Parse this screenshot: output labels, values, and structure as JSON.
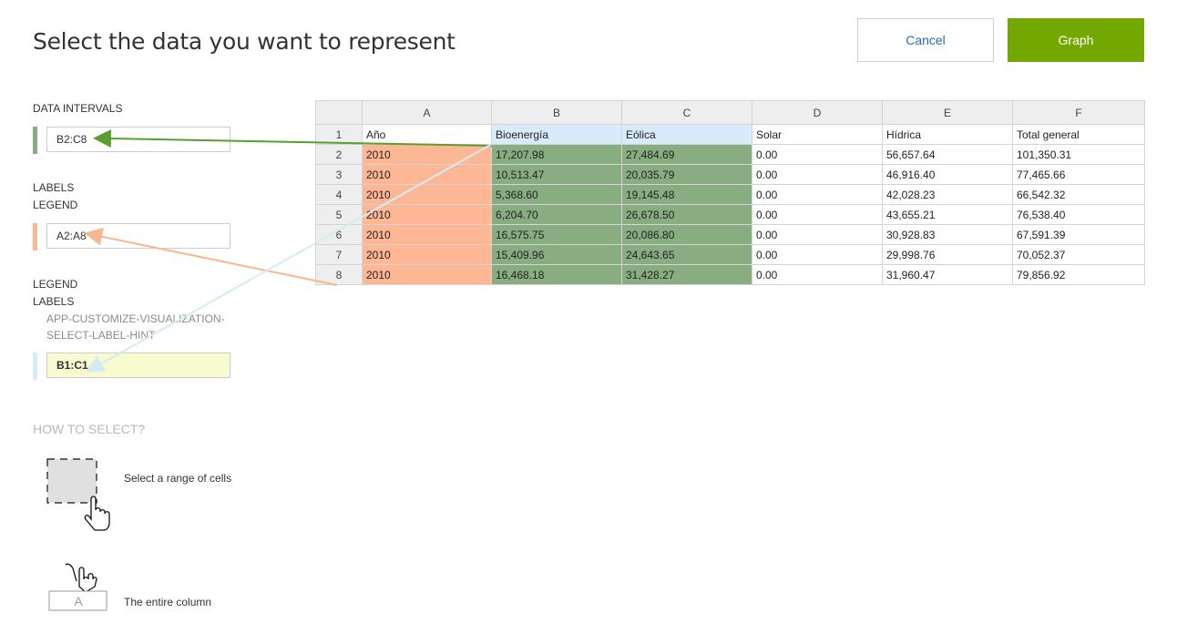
{
  "header": {
    "title": "Select the data you want to represent",
    "cancel_label": "Cancel",
    "graph_label": "Graph"
  },
  "colors": {
    "data": "#88ad80",
    "labels": "#fdb795",
    "legend": "#d8ebfa",
    "accent": "#72a800",
    "link": "#2a6ab3"
  },
  "panel": {
    "data_intervals": {
      "title": "DATA INTERVALS",
      "value": "B2:C8"
    },
    "labels_legend": {
      "line1": "LABELS",
      "line2": "LEGEND",
      "value": "A2:A8"
    },
    "legend_labels": {
      "line1": "LEGEND",
      "line2": "LABELS",
      "hint_line1": "APP-CUSTOMIZE-VISUALIZATION-",
      "hint_line2": "SELECT-LABEL-HINT",
      "value": "B1:C1"
    },
    "how_to_select": "HOW TO SELECT?",
    "help_range": "Select a range of cells",
    "help_column": "The entire column",
    "help_column_letter": "A"
  },
  "sheet": {
    "columns": [
      "A",
      "B",
      "C",
      "D",
      "E",
      "F"
    ],
    "rows": [
      {
        "num": "1",
        "cells": [
          "Año",
          "Bioenergía",
          "Eólica",
          "Solar",
          "Hídrica",
          "Total general"
        ]
      },
      {
        "num": "2",
        "cells": [
          "2010",
          "17,207.98",
          "27,484.69",
          "0.00",
          "56,657.64",
          "101,350.31"
        ]
      },
      {
        "num": "3",
        "cells": [
          "2010",
          "10,513.47",
          "20,035.79",
          "0.00",
          "46,916.40",
          "77,465.66"
        ]
      },
      {
        "num": "4",
        "cells": [
          "2010",
          "5,368.60",
          "19,145.48",
          "0.00",
          "42,028.23",
          "66,542.32"
        ]
      },
      {
        "num": "5",
        "cells": [
          "2010",
          "6,204.70",
          "26,678.50",
          "0.00",
          "43,655.21",
          "76,538.40"
        ]
      },
      {
        "num": "6",
        "cells": [
          "2010",
          "16,575.75",
          "20,086.80",
          "0.00",
          "30,928.83",
          "67,591.39"
        ]
      },
      {
        "num": "7",
        "cells": [
          "2010",
          "15,409.96",
          "24,643.65",
          "0.00",
          "29,998.76",
          "70,052.37"
        ]
      },
      {
        "num": "8",
        "cells": [
          "2010",
          "16,468.18",
          "31,428.27",
          "0.00",
          "31,960.47",
          "79,856.92"
        ]
      }
    ]
  }
}
